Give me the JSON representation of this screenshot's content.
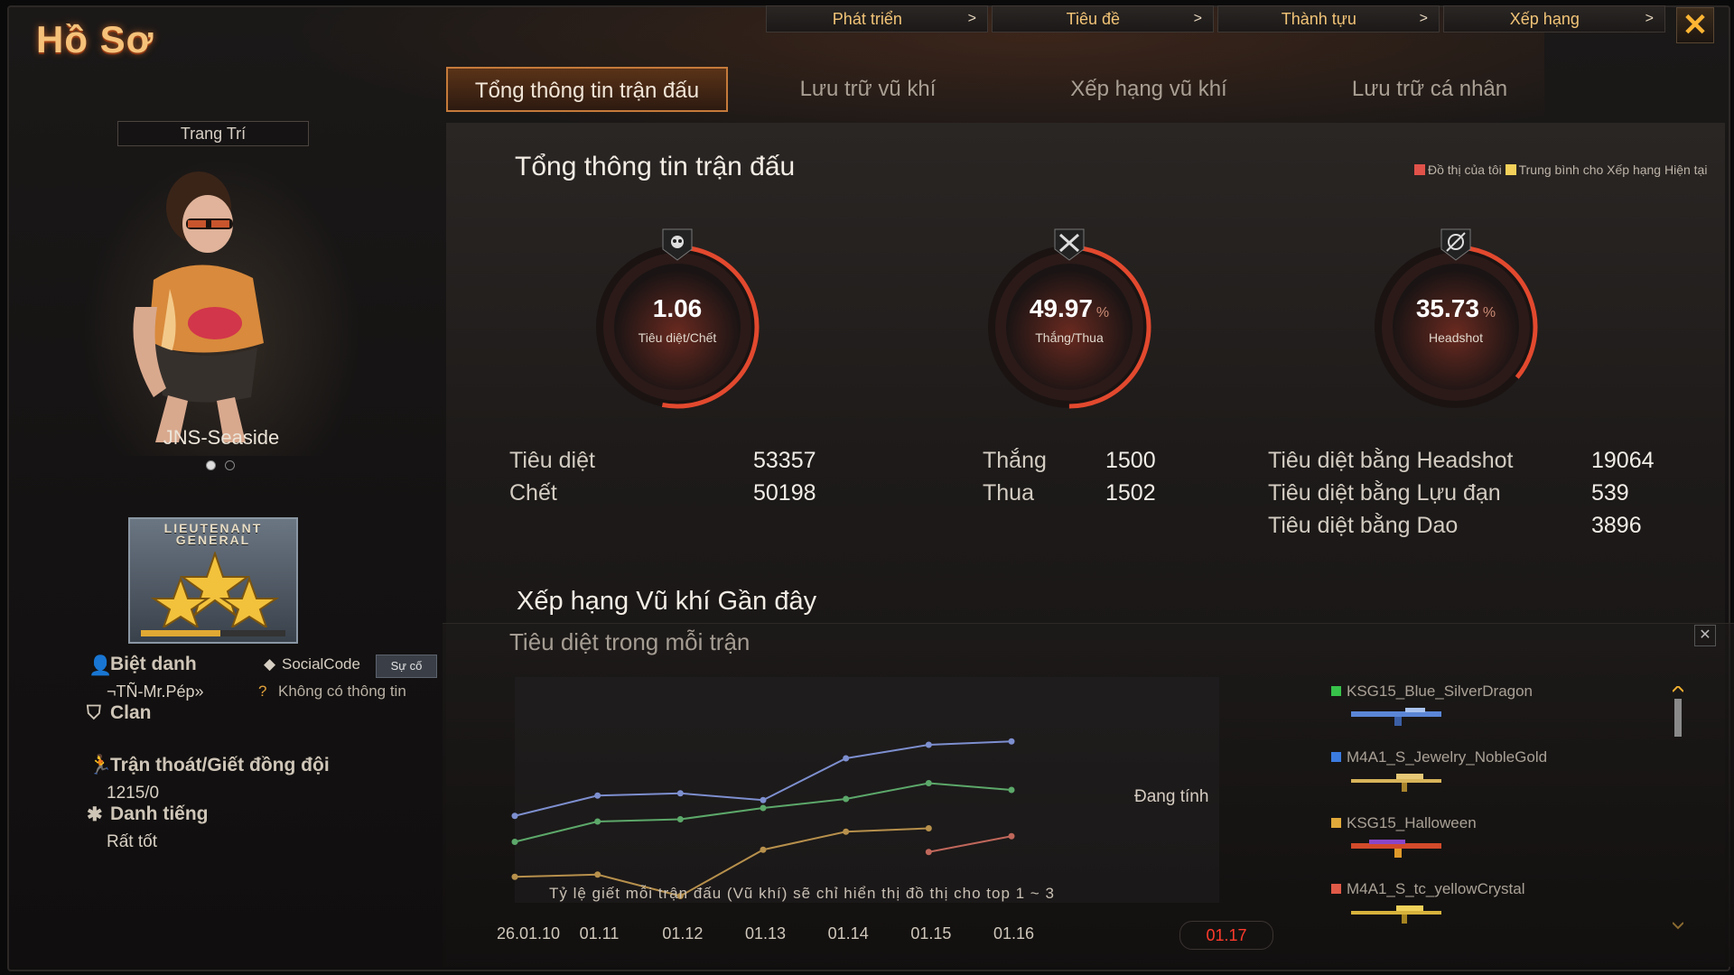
{
  "header": {
    "title": "Hồ Sơ"
  },
  "topnav": [
    {
      "label": "Phát triển"
    },
    {
      "label": "Tiêu đề"
    },
    {
      "label": "Thành tựu"
    },
    {
      "label": "Xếp hạng"
    }
  ],
  "tabs": [
    {
      "label": "Tổng thông tin trận đấu",
      "active": true
    },
    {
      "label": "Lưu trữ vũ khí"
    },
    {
      "label": "Xếp hạng vũ khí"
    },
    {
      "label": "Lưu trữ cá nhân"
    }
  ],
  "profile": {
    "decorate_label": "Trang Trí",
    "username": "JNS-Seaside",
    "rank": "LIEUTENANT GENERAL",
    "rank_progress": 0.55,
    "nickname_label": "Biệt danh",
    "nickname": "¬TÑ-Mr.Pép»",
    "socialcode_label": "SocialCode",
    "incident_button": "Sự cố",
    "no_info": "Không có thông tin",
    "clan_label": "Clan",
    "quit_label": "Trận thoát/Giết đồng đội",
    "quit_value": "1215/0",
    "reputation_label": "Danh tiếng",
    "reputation_value": "Rất tốt"
  },
  "overview": {
    "title": "Tổng thông tin trận đấu",
    "legend_mine": "Đồ thị của tôi",
    "legend_avg": "Trung bình cho Xếp hạng Hiện tại",
    "gauges": [
      {
        "value": "1.06",
        "caption": "Tiêu diệt/Chết",
        "unit": "",
        "fill": 0.53
      },
      {
        "value": "49.97",
        "caption": "Thắng/Thua",
        "unit": "%",
        "fill": 0.5
      },
      {
        "value": "35.73",
        "caption": "Headshot",
        "unit": "%",
        "fill": 0.36
      }
    ],
    "stats": {
      "kills_label": "Tiêu diệt",
      "kills": "53357",
      "deaths_label": "Chết",
      "deaths": "50198",
      "wins_label": "Thắng",
      "wins": "1500",
      "losses_label": "Thua",
      "losses": "1502",
      "hs_label": "Tiêu diệt bằng Headshot",
      "hs": "19064",
      "grenade_label": "Tiêu diệt bằng Lựu đạn",
      "grenade": "539",
      "knife_label": "Tiêu diệt bằng Dao",
      "knife": "3896"
    }
  },
  "weapons_section": {
    "title": "Xếp hạng Vũ khí Gần đây",
    "subtitle": "Tiêu diệt trong mỗi trận",
    "calculating": "Đang tính",
    "note": "Tỷ lệ giết mỗi trận đấu (Vũ khí) sẽ chỉ hiển thị đồ thị cho top 1 ~ 3",
    "active_date": "01.17",
    "weapons": [
      {
        "name": "KSG15_Blue_SilverDragon",
        "color": "#37c24a"
      },
      {
        "name": "M4A1_S_Jewelry_NobleGold",
        "color": "#3b7be0"
      },
      {
        "name": "KSG15_Halloween",
        "color": "#e0a93a"
      },
      {
        "name": "M4A1_S_tc_yellowCrystal",
        "color": "#e05a48"
      }
    ]
  },
  "chart_data": {
    "type": "line",
    "x": [
      "26.01.10",
      "01.11",
      "01.12",
      "01.13",
      "01.14",
      "01.15",
      "01.16"
    ],
    "series": [
      {
        "color": "#7d8fcf",
        "values": [
          0.77,
          0.95,
          0.97,
          0.91,
          1.28,
          1.4,
          1.43
        ]
      },
      {
        "color": "#5ca86a",
        "values": [
          0.54,
          0.72,
          0.74,
          0.84,
          0.92,
          1.06,
          1.0
        ]
      },
      {
        "color": "#b7904c",
        "values": [
          0.23,
          0.25,
          0.06,
          0.47,
          0.63,
          0.66,
          null
        ]
      },
      {
        "color": "#c0675b",
        "values": [
          null,
          null,
          null,
          null,
          null,
          0.45,
          0.59
        ]
      }
    ],
    "ylim": [
      0,
      2.0
    ],
    "grid": false
  }
}
